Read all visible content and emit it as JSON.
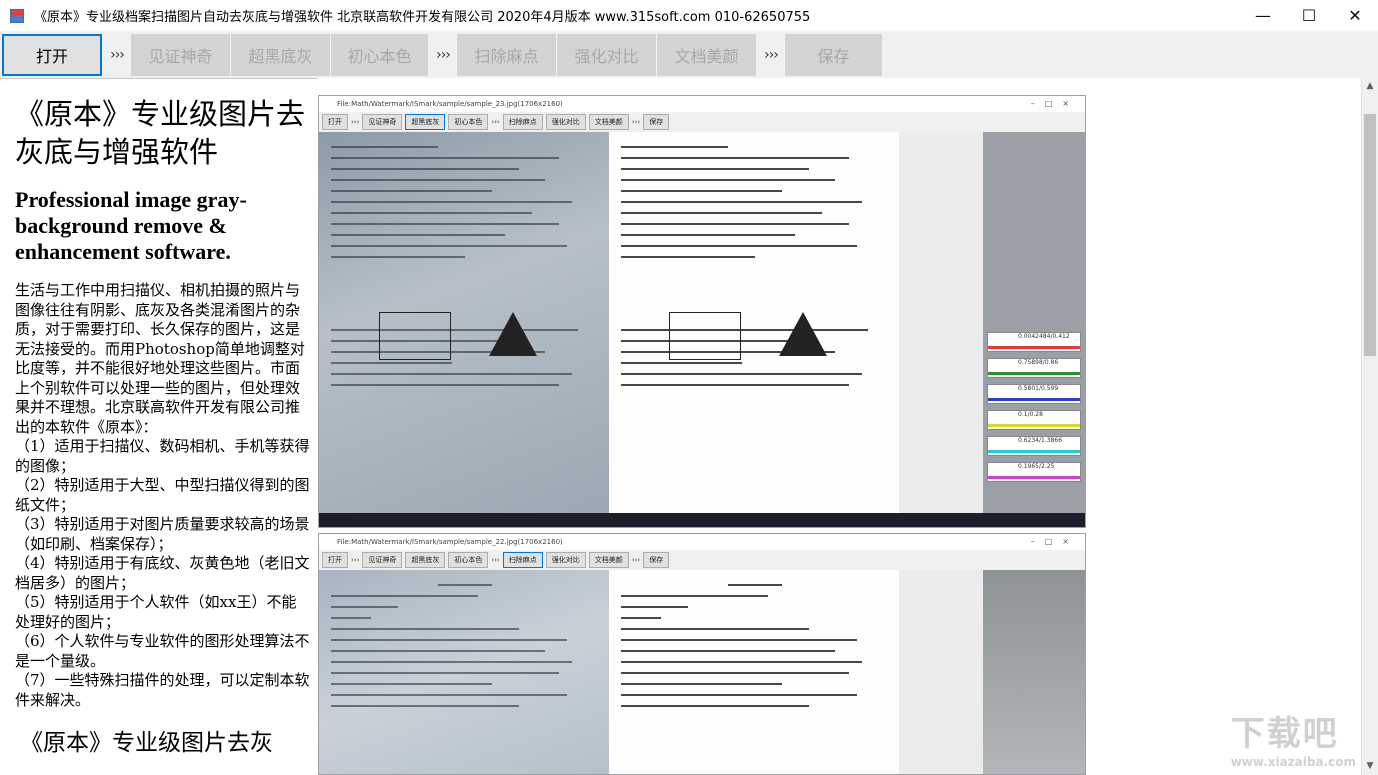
{
  "window": {
    "title": "《原本》专业级档案扫描图片自动去灰底与增强软件 北京联高软件开发有限公司 2020年4月版本 www.315soft.com 010-62650755",
    "controls": {
      "minimize": "—",
      "maximize": "☐",
      "close": "✕"
    }
  },
  "toolbar": {
    "open": "打开",
    "sep": "›››",
    "witness": "见证神奇",
    "super_black": "超黑底灰",
    "original_color": "初心本色",
    "remove_spots": "扫除麻点",
    "enhance_contrast": "强化对比",
    "doc_beautify": "文档美颜",
    "save": "保存"
  },
  "intro": {
    "title_cn": "《原本》专业级图片去灰底与增强软件",
    "title_en": "Professional image gray-background remove & enhancement software.",
    "paragraph": "生活与工作中用扫描仪、相机拍摄的照片与图像往往有阴影、底灰及各类混淆图片的杂质，对于需要打印、长久保存的图片，这是无法接受的。而用Photoshop简单地调整对比度等，并不能很好地处理这些图片。市面上个别软件可以处理一些的图片，但处理效果并不理想。北京联高软件开发有限公司推出的本软件《原本》：\n（1）适用于扫描仪、数码相机、手机等获得的图像；\n（2）特别适用于大型、中型扫描仪得到的图纸文件；\n（3）特别适用于对图片质量要求较高的场景（如印刷、档案保存）；\n（4）特别适用于有底纹、灰黄色地（老旧文档居多）的图片；\n（5）特别适用于个人软件（如xx王）不能处理好的图片；\n（6）个人软件与专业软件的图形处理算法不是一个量级。\n（7）一些特殊扫描件的处理，可以定制本软件来解决。",
    "title_cn_2": "《原本》专业级图片去灰"
  },
  "watermark": {
    "main": "下载吧",
    "sub": "www.xiazaiba.com"
  },
  "preview": {
    "shot1": {
      "title": "File:Math/Watermark/ISmark/sample/sample_23.jpg(1706x2160)",
      "active_button": "超黑底灰"
    },
    "shot2": {
      "title": "File:Math/Watermark/ISmark/sample/sample_22.jpg(1706x2160)",
      "active_button": "扫除麻点"
    },
    "mini_buttons": [
      "打开",
      "见证神奇",
      "超黑底灰",
      "初心本色",
      "扫除麻点",
      "强化对比",
      "文档美颜",
      "保存"
    ],
    "hist_labels": [
      "0.0042484/0.412",
      "0.75898/0.86",
      "0.5801/0.599",
      "0.1/0.28",
      "0.6234/1.3866",
      "0.1965/2.25"
    ],
    "hist_colors": [
      "#e23b3b",
      "#2e8b2e",
      "#2a3fd0",
      "#d8d820",
      "#20c8d8",
      "#cc40cc"
    ]
  },
  "scroll": {
    "up": "▲",
    "down": "▼",
    "position": 0.0
  }
}
